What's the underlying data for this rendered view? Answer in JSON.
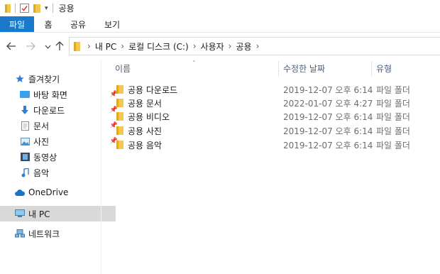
{
  "window": {
    "title": "공용"
  },
  "ribbon": {
    "tabs": [
      "파일",
      "홈",
      "공유",
      "보기"
    ]
  },
  "address": {
    "crumbs": [
      "내 PC",
      "로컬 디스크 (C:)",
      "사용자",
      "공용"
    ]
  },
  "sidebar": {
    "items": [
      {
        "label": "즐겨찾기",
        "icon": "star-icon"
      },
      {
        "label": "바탕 화면",
        "icon": "desktop-icon",
        "pinned": true
      },
      {
        "label": "다운로드",
        "icon": "download-icon",
        "pinned": true
      },
      {
        "label": "문서",
        "icon": "document-icon",
        "pinned": true
      },
      {
        "label": "사진",
        "icon": "pictures-icon",
        "pinned": true
      },
      {
        "label": "동영상",
        "icon": "video-icon"
      },
      {
        "label": "음악",
        "icon": "music-icon"
      },
      {
        "label": "OneDrive",
        "icon": "cloud-icon"
      },
      {
        "label": "내 PC",
        "icon": "computer-icon",
        "selected": true
      },
      {
        "label": "네트워크",
        "icon": "network-icon"
      }
    ]
  },
  "columns": {
    "name": "이름",
    "date": "수정한 날짜",
    "type": "유형"
  },
  "files": [
    {
      "name": "공용 다운로드",
      "date": "2019-12-07 오후 6:14",
      "type": "파일 폴더"
    },
    {
      "name": "공용 문서",
      "date": "2022-01-07 오후 4:27",
      "type": "파일 폴더"
    },
    {
      "name": "공용 비디오",
      "date": "2019-12-07 오후 6:14",
      "type": "파일 폴더"
    },
    {
      "name": "공용 사진",
      "date": "2019-12-07 오후 6:14",
      "type": "파일 폴더"
    },
    {
      "name": "공용 음악",
      "date": "2019-12-07 오후 6:14",
      "type": "파일 폴더"
    }
  ],
  "colors": {
    "accent": "#1979ca",
    "selected": "#d9d9d9",
    "folder": "#f2c94c",
    "headerText": "#4c6079"
  }
}
